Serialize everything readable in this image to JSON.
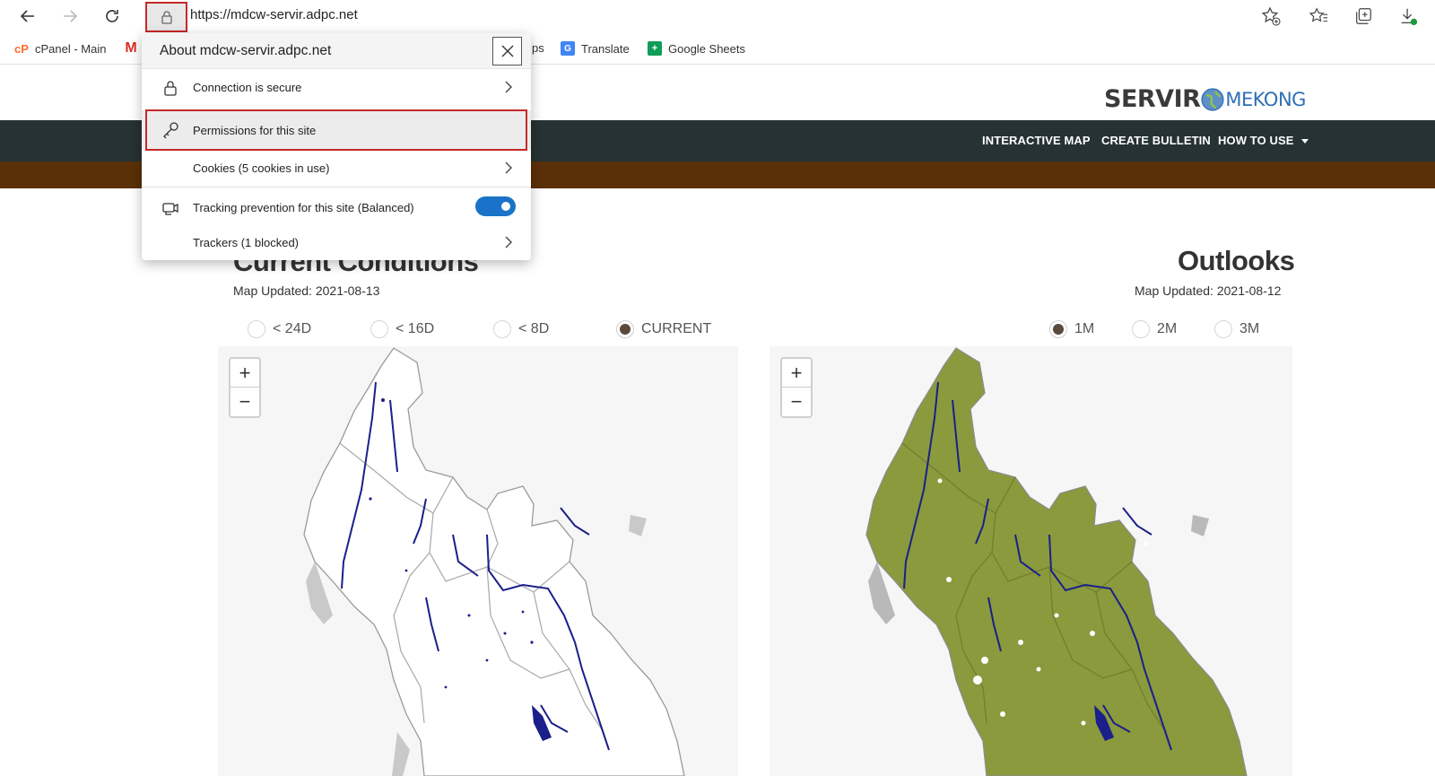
{
  "browser": {
    "url": "https://mdcw-servir.adpc.net",
    "bookmarks": [
      {
        "label": "cPanel - Main",
        "icon": "cpanel-icon"
      },
      {
        "label": "",
        "icon": "gmail-icon"
      },
      {
        "label": "ps",
        "icon": ""
      },
      {
        "label": "Translate",
        "icon": "google-translate-icon"
      },
      {
        "label": "Google Sheets",
        "icon": "google-sheets-icon"
      }
    ]
  },
  "popup": {
    "title": "About mdcw-servir.adpc.net",
    "rows": [
      {
        "label": "Connection is secure",
        "icon": "lock-icon"
      },
      {
        "label": "Permissions for this site",
        "icon": "key-icon"
      },
      {
        "label": "Cookies (5 cookies in use)",
        "icon": ""
      },
      {
        "label": "Tracking prevention for this site (Balanced)",
        "icon": "tracking-icon",
        "toggle": "on"
      },
      {
        "label": "Trackers (1 blocked)",
        "icon": ""
      }
    ]
  },
  "site": {
    "logo_text": "SERVIR",
    "logo_suffix": "MEKONG",
    "nav": [
      "INTERACTIVE MAP",
      "CREATE BULLETIN",
      "HOW TO USE"
    ]
  },
  "current": {
    "title": "Current Conditions",
    "updated": "Map Updated: 2021-08-13",
    "options": [
      "< 24D",
      "< 16D",
      "< 8D",
      "CURRENT"
    ],
    "selected": "CURRENT"
  },
  "outlooks": {
    "title": "Outlooks",
    "updated": "Map Updated: 2021-08-12",
    "options": [
      "1M",
      "2M",
      "3M"
    ],
    "selected": "1M"
  },
  "map_controls": {
    "zoom_in": "+",
    "zoom_out": "−"
  },
  "colors": {
    "nav_bg": "#263233",
    "brown_bar": "#5a3008",
    "land_green": "#8a9a3c",
    "water": "#1b1f8a",
    "toggle": "#1a73c9",
    "highlight": "#c62828"
  }
}
